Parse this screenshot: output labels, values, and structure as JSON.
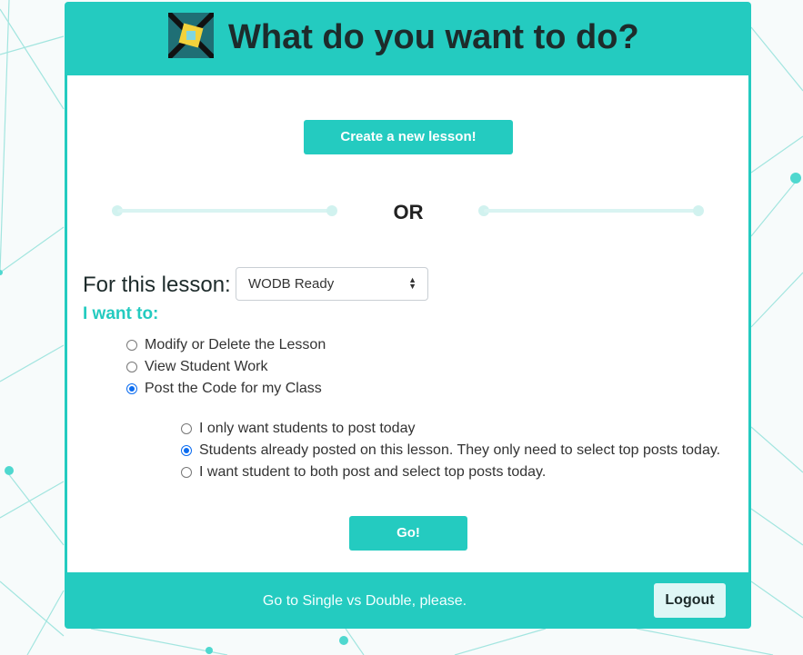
{
  "header": {
    "title": "What do you want to do?",
    "logo_icon": "puzzle-hands-logo"
  },
  "create_button": "Create a new lesson!",
  "divider_text": "OR",
  "lesson": {
    "label": "For this lesson:",
    "select_value": "WODB Ready"
  },
  "want": {
    "label": "I want to:",
    "options": [
      {
        "label": "Modify or Delete the Lesson",
        "checked": false
      },
      {
        "label": "View Student Work",
        "checked": false
      },
      {
        "label": "Post the Code for my Class",
        "checked": true
      }
    ],
    "sub_options": [
      {
        "label": "I only want students to post today",
        "checked": false
      },
      {
        "label": "Students already posted on this lesson. They only need to select top posts today.",
        "checked": true
      },
      {
        "label": "I want student to both post and select top posts today.",
        "checked": false
      }
    ]
  },
  "go_button": "Go!",
  "footer": {
    "text": "Go to Single vs Double, please.",
    "logout": "Logout"
  },
  "colors": {
    "accent": "#24cbc0",
    "radio_checked": "#0b6cf0"
  }
}
